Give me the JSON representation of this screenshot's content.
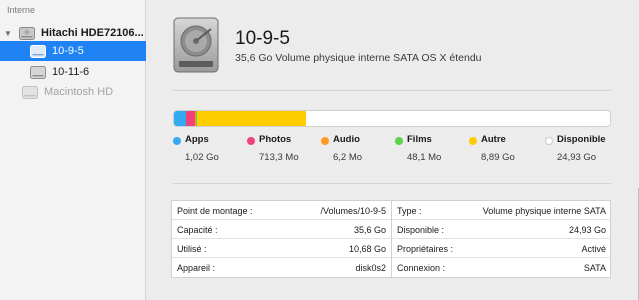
{
  "sidebar": {
    "section": "Interne",
    "disk": "Hitachi HDE72106...",
    "volumes": [
      "10-9-5",
      "10-11-6",
      "Macintosh HD"
    ]
  },
  "header": {
    "title": "10-9-5",
    "subtitle": "35,6 Go Volume physique interne SATA OS X étendu"
  },
  "usage": {
    "total_go": 35.6,
    "items": [
      {
        "name": "Apps",
        "value": "1,02 Go",
        "color": "#33aaf0",
        "fraction": 0.0287
      },
      {
        "name": "Photos",
        "value": "713,3 Mo",
        "color": "#f2417a",
        "fraction": 0.02
      },
      {
        "name": "Audio",
        "value": "6,2 Mo",
        "color": "#ff9b1c",
        "fraction": 0.0002
      },
      {
        "name": "Films",
        "value": "48,1 Mo",
        "color": "#5bd447",
        "fraction": 0.0014
      },
      {
        "name": "Autre",
        "value": "8,89 Go",
        "color": "#ffcc00",
        "fraction": 0.2497
      },
      {
        "name": "Disponible",
        "value": "24,93 Go",
        "color": "#ffffff",
        "fraction": 0.7
      }
    ]
  },
  "info": {
    "left": [
      {
        "key": "Point de montage :",
        "value": "/Volumes/10-9-5"
      },
      {
        "key": "Capacité :",
        "value": "35,6 Go"
      },
      {
        "key": "Utilisé :",
        "value": "10,68 Go"
      },
      {
        "key": "Appareil :",
        "value": "disk0s2"
      }
    ],
    "right": [
      {
        "key": "Type :",
        "value": "Volume physique interne SATA"
      },
      {
        "key": "Disponible :",
        "value": "24,93 Go"
      },
      {
        "key": "Propriétaires :",
        "value": "Activé"
      },
      {
        "key": "Connexion :",
        "value": "SATA"
      }
    ]
  }
}
